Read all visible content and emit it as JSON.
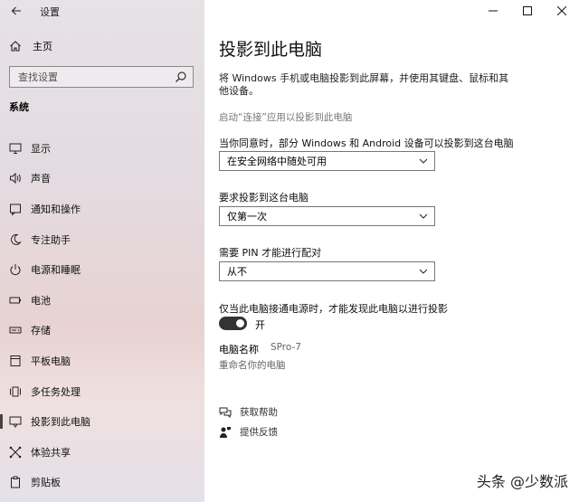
{
  "window": {
    "title": "设置"
  },
  "sidebar": {
    "home_label": "主页",
    "search_placeholder": "查找设置",
    "section": "系统",
    "items": [
      {
        "label": "显示",
        "icon": "monitor-icon"
      },
      {
        "label": "声音",
        "icon": "speaker-icon"
      },
      {
        "label": "通知和操作",
        "icon": "notification-icon"
      },
      {
        "label": "专注助手",
        "icon": "moon-icon"
      },
      {
        "label": "电源和睡眠",
        "icon": "power-icon"
      },
      {
        "label": "电池",
        "icon": "battery-icon"
      },
      {
        "label": "存储",
        "icon": "storage-icon"
      },
      {
        "label": "平板电脑",
        "icon": "tablet-icon"
      },
      {
        "label": "多任务处理",
        "icon": "multitask-icon"
      },
      {
        "label": "投影到此电脑",
        "icon": "project-icon",
        "active": true
      },
      {
        "label": "体验共享",
        "icon": "share-icon"
      },
      {
        "label": "剪贴板",
        "icon": "clipboard-icon"
      }
    ]
  },
  "main": {
    "title": "投影到此电脑",
    "description": "将 Windows 手机或电脑投影到此屏幕，并使用其键盘、鼠标和其他设备。",
    "launch_link": "启动“连接”应用以投影到此电脑",
    "setting1_label": "当你同意时，部分 Windows 和 Android 设备可以投影到这台电脑",
    "setting1_value": "在安全网络中随处可用",
    "setting2_label": "要求投影到这台电脑",
    "setting2_value": "仅第一次",
    "setting3_label": "需要 PIN 才能进行配对",
    "setting3_value": "从不",
    "toggle_label": "仅当此电脑接通电源时，才能发现此电脑以进行投影",
    "toggle_state": "开",
    "pc_name_label": "电脑名称",
    "pc_name_value": "SPro-7",
    "rename_link": "重命名你的电脑",
    "help_label": "获取帮助",
    "feedback_label": "提供反馈"
  },
  "watermark": {
    "text": "头条 @少数派"
  },
  "colors": {
    "sidebar_top": "#e6e2e6",
    "sidebar_mid": "#e8d2d2",
    "toggle_on": "#333333"
  }
}
